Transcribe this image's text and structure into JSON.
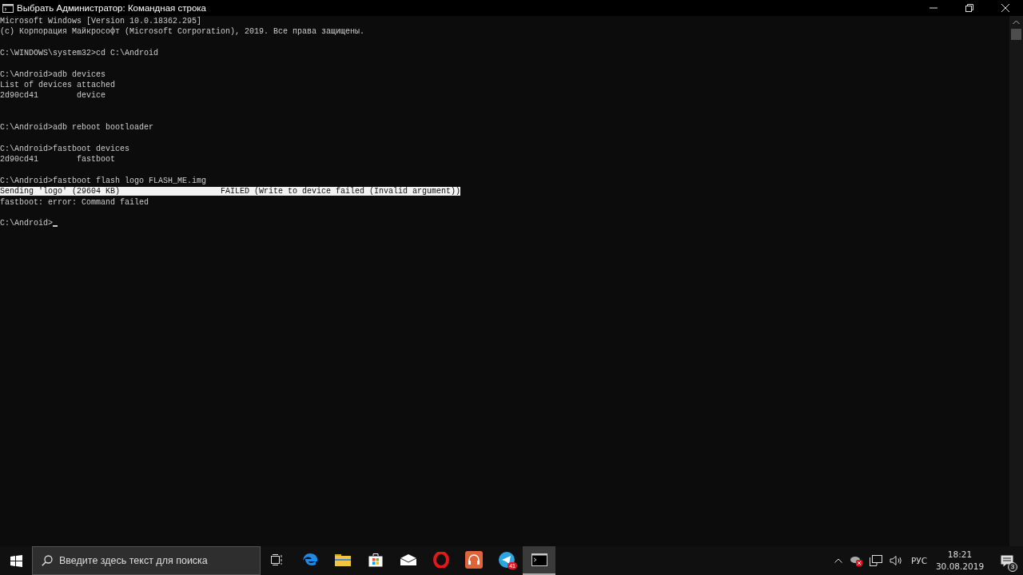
{
  "window": {
    "title": "Выбрать Администратор: Командная строка"
  },
  "console": [
    {
      "kind": "text",
      "text": "Microsoft Windows [Version 10.0.18362.295]"
    },
    {
      "kind": "text",
      "text": "(c) Корпорация Майкрософт (Microsoft Corporation), 2019. Все права защищены."
    },
    {
      "kind": "blank"
    },
    {
      "kind": "text",
      "text": "C:\\WINDOWS\\system32>cd C:\\Android"
    },
    {
      "kind": "blank"
    },
    {
      "kind": "text",
      "text": "C:\\Android>adb devices"
    },
    {
      "kind": "text",
      "text": "List of devices attached"
    },
    {
      "kind": "text",
      "text": "2d90cd41        device"
    },
    {
      "kind": "blank"
    },
    {
      "kind": "blank"
    },
    {
      "kind": "text",
      "text": "C:\\Android>adb reboot bootloader"
    },
    {
      "kind": "blank"
    },
    {
      "kind": "text",
      "text": "C:\\Android>fastboot devices"
    },
    {
      "kind": "text",
      "text": "2d90cd41        fastboot"
    },
    {
      "kind": "blank"
    },
    {
      "kind": "text",
      "text": "C:\\Android>fastboot flash logo FLASH_ME.img"
    },
    {
      "kind": "selected",
      "text": "Sending 'logo' (29604 KB)                     FAILED (Write to device failed (Invalid argument))"
    },
    {
      "kind": "text",
      "text": "fastboot: error: Command failed"
    },
    {
      "kind": "blank"
    },
    {
      "kind": "prompt",
      "text": "C:\\Android>"
    }
  ],
  "taskbar": {
    "search": {
      "placeholder": "Введите здесь текст для поиска"
    },
    "apps": [
      {
        "kind": "taskview",
        "selected": false
      },
      {
        "kind": "edge",
        "selected": false
      },
      {
        "kind": "explorer",
        "selected": false
      },
      {
        "kind": "store",
        "selected": false
      },
      {
        "kind": "mail",
        "selected": false
      },
      {
        "kind": "opera",
        "selected": false
      },
      {
        "kind": "music",
        "selected": false
      },
      {
        "kind": "telegram",
        "selected": false,
        "badge": "41"
      },
      {
        "kind": "cmd",
        "selected": true
      }
    ],
    "language": "РУС",
    "time": "18:21",
    "date": "30.08.2019",
    "notifications": "3"
  }
}
